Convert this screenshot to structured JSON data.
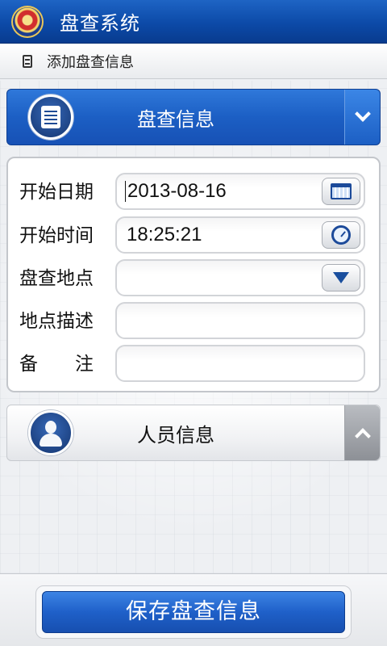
{
  "app": {
    "title": "盘查系统"
  },
  "subheader": {
    "label": "添加盘查信息"
  },
  "sections": {
    "inspection": {
      "title": "盘查信息",
      "expanded": true
    },
    "personnel": {
      "title": "人员信息",
      "expanded": false
    }
  },
  "form": {
    "start_date": {
      "label": "开始日期",
      "value": "2013-08-16"
    },
    "start_time": {
      "label": "开始时间",
      "value": "18:25:21"
    },
    "location": {
      "label": "盘查地点",
      "value": ""
    },
    "location_desc": {
      "label": "地点描述",
      "value": ""
    },
    "remarks": {
      "label": "备　　注",
      "value": ""
    }
  },
  "actions": {
    "save_label": "保存盘查信息"
  },
  "colors": {
    "primary": "#1c5fc4",
    "title_bar": "#0c4aa8"
  }
}
